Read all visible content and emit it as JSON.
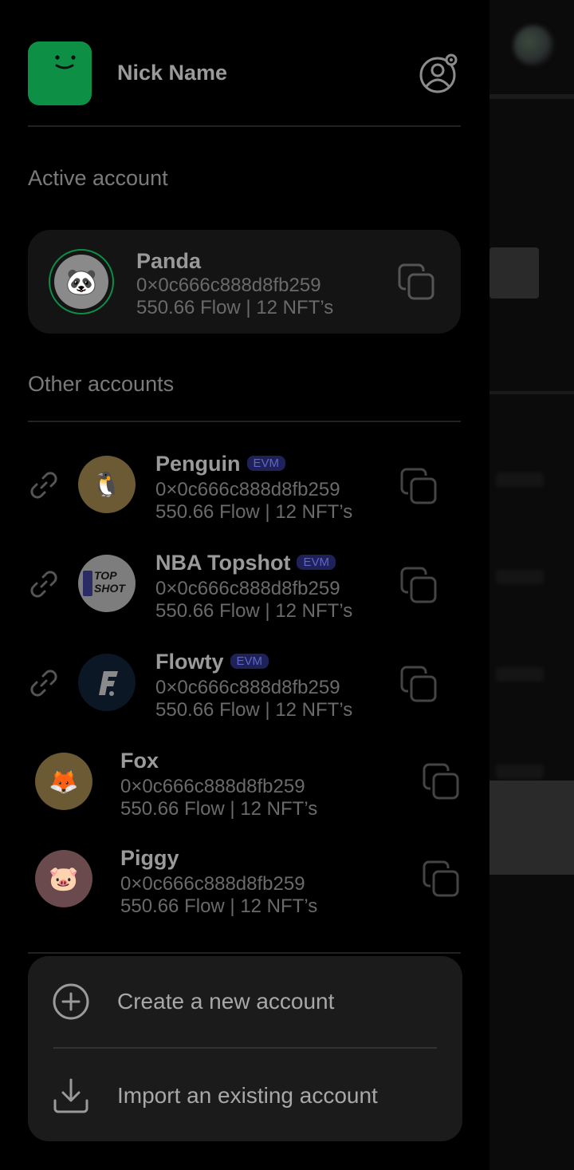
{
  "header": {
    "user_name": "Nick Name",
    "settings_icon": "account-settings-icon"
  },
  "active_section": {
    "label": "Active account",
    "account": {
      "name": "Panda",
      "address": "0×0c666c888d8fb259",
      "balance": "550.66 Flow | 12 NFT’s"
    }
  },
  "other_section": {
    "label": "Other accounts",
    "accounts": [
      {
        "name": "Penguin",
        "badge": "EVM",
        "address": "0×0c666c888d8fb259",
        "balance": "550.66 Flow | 12 NFT’s",
        "linked": true
      },
      {
        "name": "NBA Topshot",
        "badge": "EVM",
        "address": "0×0c666c888d8fb259",
        "balance": "550.66 Flow | 12 NFT’s",
        "linked": true,
        "logo_text": "TOP SHOT"
      },
      {
        "name": "Flowty",
        "badge": "EVM",
        "address": "0×0c666c888d8fb259",
        "balance": "550.66 Flow | 12 NFT’s",
        "linked": true
      },
      {
        "name": "Fox",
        "address": "0×0c666c888d8fb259",
        "balance": "550.66 Flow | 12 NFT’s",
        "linked": false
      },
      {
        "name": "Piggy",
        "address": "0×0c666c888d8fb259",
        "balance": "550.66 Flow | 12 NFT’s",
        "linked": false
      }
    ]
  },
  "actions": {
    "create_label": "Create a new account",
    "import_label": "Import an existing account"
  },
  "colors": {
    "brand_green": "#0d8f46",
    "evm_badge_bg": "#1f2259",
    "evm_badge_text": "#5e66c8"
  }
}
